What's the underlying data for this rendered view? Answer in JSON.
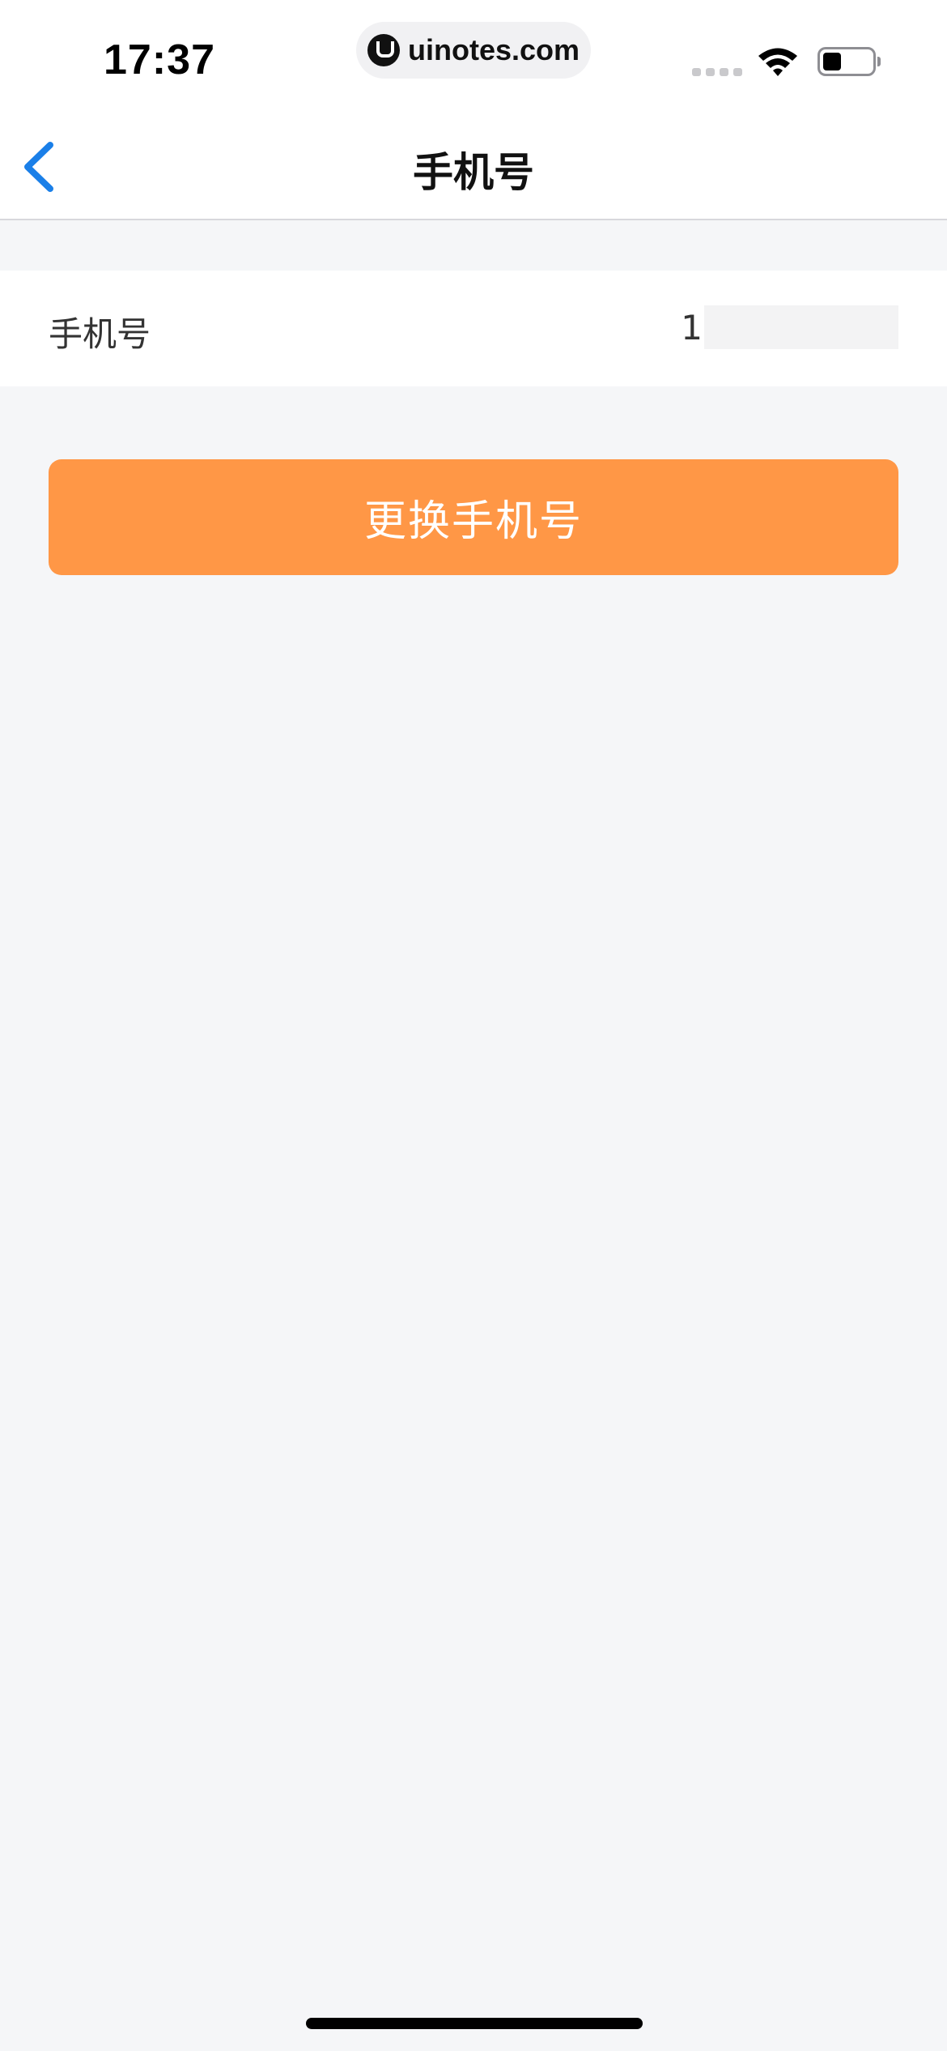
{
  "status_bar": {
    "time": "17:37",
    "watermark": "uinotes.com"
  },
  "nav": {
    "title": "手机号"
  },
  "phone_row": {
    "label": "手机号",
    "value": "1"
  },
  "actions": {
    "change_label": "更换手机号"
  },
  "colors": {
    "accent": "#ff9746",
    "back": "#1a7fe8",
    "background": "#f5f6f8"
  }
}
